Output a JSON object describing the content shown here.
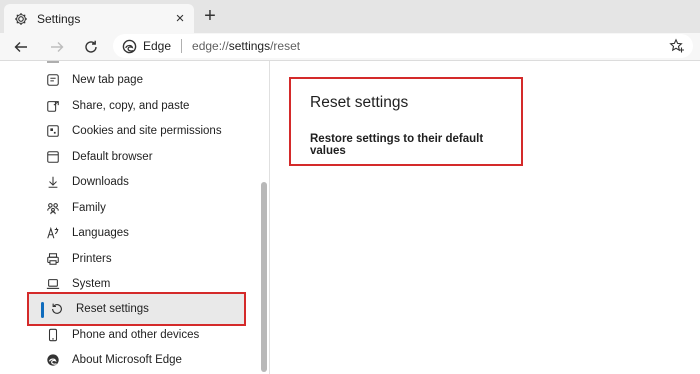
{
  "tab": {
    "title": "Settings",
    "close": "×"
  },
  "new_tab": "+",
  "address": {
    "site": "Edge",
    "url_prefix": "edge://",
    "url_path": "settings",
    "url_suffix": "/reset"
  },
  "sidebar": {
    "items": [
      {
        "label": "New tab page",
        "icon": "new-tab-icon"
      },
      {
        "label": "Share, copy, and paste",
        "icon": "share-icon"
      },
      {
        "label": "Cookies and site permissions",
        "icon": "cookies-icon"
      },
      {
        "label": "Default browser",
        "icon": "default-browser-icon"
      },
      {
        "label": "Downloads",
        "icon": "download-icon"
      },
      {
        "label": "Family",
        "icon": "family-icon"
      },
      {
        "label": "Languages",
        "icon": "languages-icon"
      },
      {
        "label": "Printers",
        "icon": "printer-icon"
      },
      {
        "label": "System",
        "icon": "laptop-icon"
      },
      {
        "label": "Reset settings",
        "icon": "reset-icon",
        "active": true
      },
      {
        "label": "Phone and other devices",
        "icon": "phone-icon"
      },
      {
        "label": "About Microsoft Edge",
        "icon": "edge-icon"
      }
    ]
  },
  "main": {
    "heading": "Reset settings",
    "option": "Restore settings to their default values"
  },
  "colors": {
    "highlight_border": "#d42a2a",
    "active_bar": "#0f6cbd"
  }
}
